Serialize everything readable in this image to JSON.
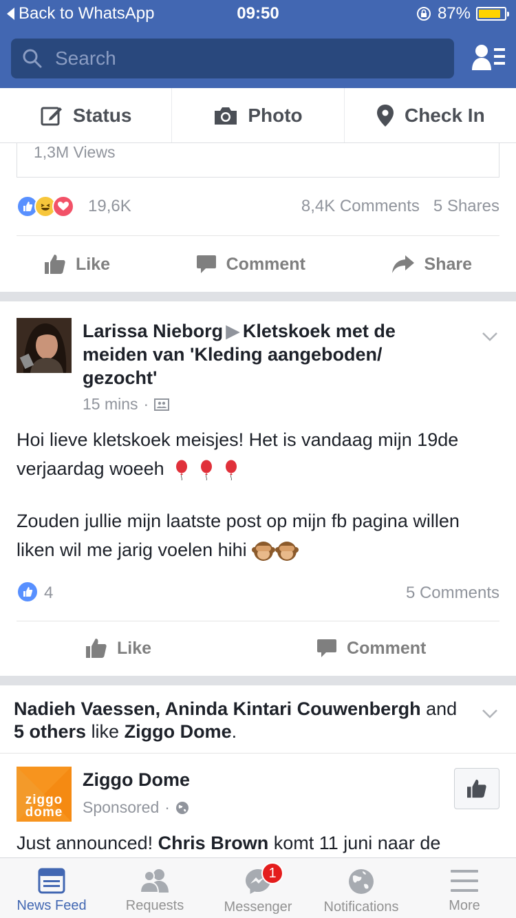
{
  "status_bar": {
    "back_label": "Back to WhatsApp",
    "time": "09:50",
    "battery": "87%",
    "battery_level": 0.87
  },
  "search": {
    "placeholder": "Search"
  },
  "composer": {
    "status": "Status",
    "photo": "Photo",
    "checkin": "Check In"
  },
  "post1": {
    "views": "1,3M Views",
    "reactions_count": "19,6K",
    "comments_shares": "8,4K Comments   5 Shares",
    "actions": {
      "like": "Like",
      "comment": "Comment",
      "share": "Share"
    }
  },
  "post2": {
    "author": "Larissa Nieborg",
    "group": "Kletskoek met de meiden van 'Kleding aangeboden/ gezocht'",
    "time": "15 mins",
    "body_1": "Hoi lieve kletskoek meisjes! Het is vandaag mijn 19de verjaardag woeeh",
    "body_2": "Zouden jullie mijn laatste post op mijn fb pagina willen liken wil me jarig voelen hihi",
    "likes": "4",
    "comments": "5 Comments",
    "actions": {
      "like": "Like",
      "comment": "Comment"
    }
  },
  "post3": {
    "friends": "Nadieh Vaessen, Aninda Kintari Couwenbergh",
    "and_text": "and",
    "others": "5 others",
    "like_text": "like",
    "page": "Ziggo Dome",
    "period": ".",
    "page_name": "Ziggo Dome",
    "logo_line1": "ziggo",
    "logo_line2": "dome",
    "sponsored": "Sponsored",
    "announce_pre": "Just announced!",
    "announce_bold": "Chris Brown",
    "announce_post": "komt 11 juni naar de"
  },
  "tabs": {
    "news_feed": "News Feed",
    "requests": "Requests",
    "messenger": "Messenger",
    "messenger_badge": "1",
    "notifications": "Notifications",
    "more": "More"
  },
  "colors": {
    "brand": "#4267b2",
    "search_bg": "#29487d",
    "badge": "#e41d1d",
    "battery": "#ffd400"
  }
}
